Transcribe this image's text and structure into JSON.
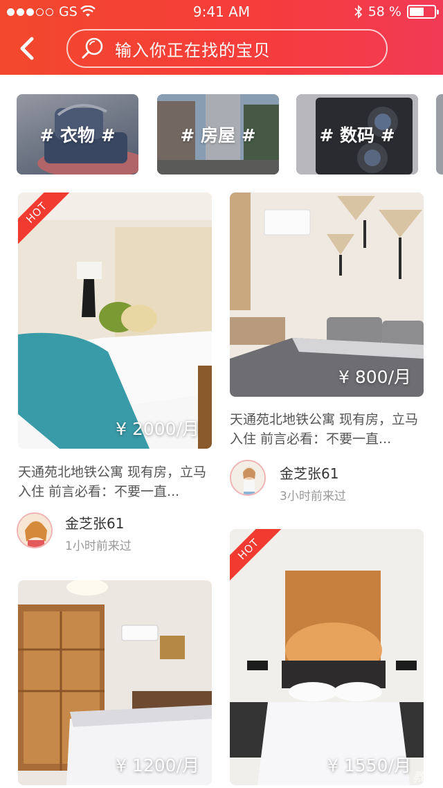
{
  "status_bar": {
    "carrier": "GS",
    "time": "9:41 AM",
    "battery": "58 %"
  },
  "search": {
    "placeholder": "输入你正在找的宝贝"
  },
  "categories": [
    {
      "label": "# 衣物 #"
    },
    {
      "label": "# 房屋 #"
    },
    {
      "label": "# 数码 #"
    }
  ],
  "listings": [
    {
      "price": "¥ 2000/月",
      "hot": "HOT",
      "description": "天通苑北地铁公寓 现有房，立马入住 前言必看：不要一直...",
      "user": "金芝张61",
      "last_seen": "1小时前来过"
    },
    {
      "price": "¥ 800/月",
      "description": "天通苑北地铁公寓 现有房，立马入住 前言必看：不要一直...",
      "user": "金芝张61",
      "last_seen": "3小时前来过"
    },
    {
      "price": "¥ 1200/月"
    },
    {
      "price": "¥ 1550/月",
      "hot": "HOT"
    }
  ],
  "watermark": "教程"
}
